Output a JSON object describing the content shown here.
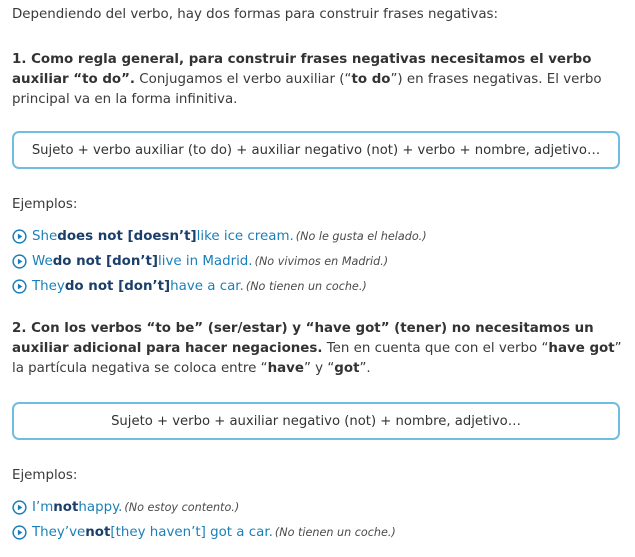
{
  "intro": "Dependiendo del verbo, hay dos formas para construir frases negativas:",
  "rule1": {
    "bold": "1. Como regla general, para construir frases negativas necesitamos el verbo auxiliar “to do”.",
    "p2_a": " Conjugamos el verbo auxiliar (“",
    "p2_b": "to do",
    "p2_c": "”) en frases negativas. El verbo principal va en la forma infinitiva.",
    "formula": "Sujeto + verbo auxiliar (to do) + auxiliar negativo (not) + verbo + nombre, adjetivo…",
    "examples_label": "Ejemplos:",
    "examples": [
      {
        "pre": "She ",
        "neg": "does not [doesn’t]",
        "post": " like ice cream.",
        "tr": "(No le gusta el helado.)"
      },
      {
        "pre": "We ",
        "neg": "do not [don’t]",
        "post": " live in Madrid.",
        "tr": "(No vivimos en Madrid.)"
      },
      {
        "pre": "They ",
        "neg": "do not [don’t]",
        "post": " have a car.",
        "tr": "(No tienen un coche.)"
      }
    ]
  },
  "rule2": {
    "bold": "2. Con los verbos “to be” (ser/estar) y “have got” (tener) no necesitamos un auxiliar adicional para hacer negaciones.",
    "t1": " Ten en cuenta que con el verbo “",
    "b1": "have got",
    "t2": "” la partícula negativa se coloca entre “",
    "b2": "have",
    "t3": "” y “",
    "b3": "got",
    "t4": "”.",
    "formula": "Sujeto + verbo + auxiliar negativo (not) + nombre, adjetivo…",
    "examples_label": "Ejemplos:",
    "examples": [
      {
        "pre": "I’m ",
        "neg": "not",
        "post": " happy.",
        "tr": "(No estoy contento.)"
      },
      {
        "pre": "They’ve ",
        "neg": "not",
        "post": " [they haven’t] got a car.",
        "tr": "(No tienen un coche.)"
      }
    ]
  },
  "colors": {
    "accent": "#1a7fb8",
    "border": "#6fbde0",
    "negative": "#1b3f6b"
  },
  "icons": {
    "example": "play-circle-icon"
  }
}
